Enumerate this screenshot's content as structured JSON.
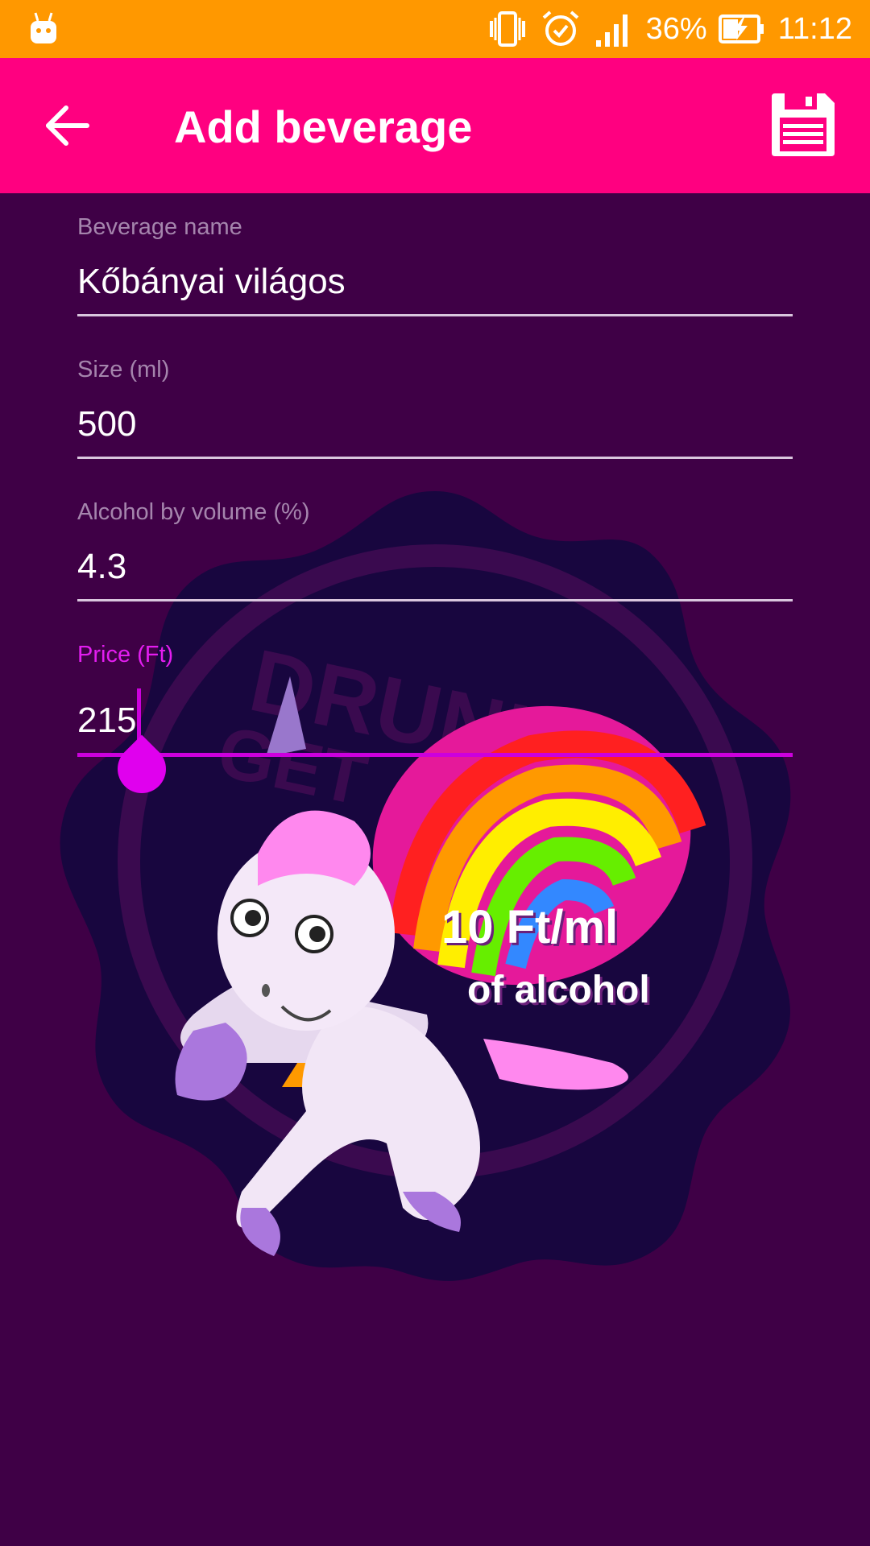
{
  "status_bar": {
    "battery": "36%",
    "time": "11:12",
    "icons": [
      "android-debug-icon",
      "vibrate-icon",
      "alarm-icon",
      "signal-icon",
      "battery-charging-icon"
    ]
  },
  "toolbar": {
    "title": "Add beverage",
    "back_icon": "arrow-left-icon",
    "save_icon": "floppy-disk-icon",
    "color": "#ff0080"
  },
  "form": {
    "name": {
      "label": "Beverage name",
      "value": "Kőbányai világos"
    },
    "size": {
      "label": "Size (ml)",
      "value": "500"
    },
    "abv": {
      "label": "Alcohol by volume (%)",
      "value": "4.3"
    },
    "price": {
      "label": "Price (Ft)",
      "value": "215"
    }
  },
  "promo": {
    "line1": "10 Ft/ml",
    "line2": "of alcohol"
  },
  "colors": {
    "status_bar": "#ff9800",
    "background": "#3f0046",
    "accent": "#cc00dd"
  }
}
